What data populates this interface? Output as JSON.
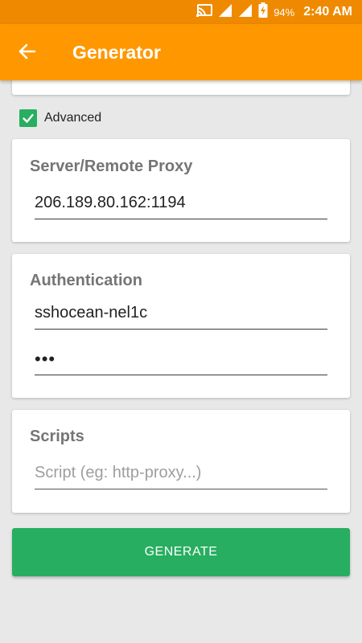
{
  "status_bar": {
    "icons": [
      "cast-icon",
      "signal-icon",
      "signal-icon",
      "battery-charging-icon"
    ],
    "battery_percent": "94%",
    "time": "2:40 AM"
  },
  "app_bar": {
    "back_icon": "arrow-back-icon",
    "title": "Generator",
    "color": "#ff9800",
    "status_color": "#ef8a00"
  },
  "advanced": {
    "label": "Advanced",
    "checked": true,
    "color": "#27ae60"
  },
  "server": {
    "title": "Server/Remote Proxy",
    "value": "206.189.80.162:1194"
  },
  "auth": {
    "title": "Authentication",
    "username": "sshocean-nel1c",
    "password": "•••"
  },
  "scripts": {
    "title": "Scripts",
    "value": "",
    "placeholder": "Script (eg: http-proxy...)"
  },
  "generate": {
    "label": "GENERATE",
    "color": "#27ae60"
  }
}
